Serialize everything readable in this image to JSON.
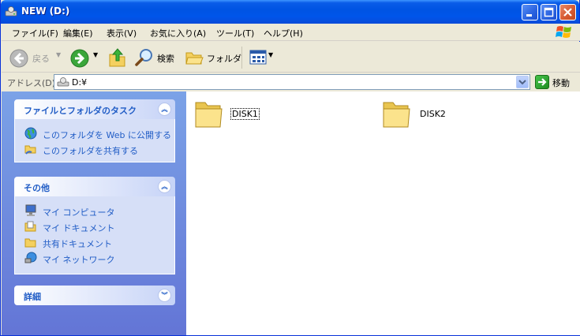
{
  "window": {
    "title": "NEW (D:)",
    "buttons": {
      "minimize": "minimize",
      "maximize": "maximize",
      "close": "close"
    }
  },
  "menu": [
    "ファイル(F)",
    "編集(E)",
    "表示(V)",
    "お気に入り(A)",
    "ツール(T)",
    "ヘルプ(H)"
  ],
  "toolbar": {
    "back_label": "戻る",
    "search_label": "検索",
    "folders_label": "フォルダ"
  },
  "address": {
    "label": "アドレス(D)",
    "value": "D:¥",
    "go_label": "移動"
  },
  "tasks": {
    "file_tasks": {
      "title": "ファイルとフォルダのタスク",
      "items": [
        "このフォルダを Web に公開する",
        "このフォルダを共有する"
      ]
    },
    "other_places": {
      "title": "その他",
      "items": [
        "マイ コンピュータ",
        "マイ ドキュメント",
        "共有ドキュメント",
        "マイ ネットワーク"
      ]
    },
    "details": {
      "title": "詳細"
    }
  },
  "files": [
    {
      "name": "DISK1",
      "selected": true
    },
    {
      "name": "DISK2",
      "selected": false
    }
  ],
  "colors": {
    "titlebar": "#0054e3",
    "taskpane": "#6f8edc",
    "task_link": "#215dc6"
  }
}
